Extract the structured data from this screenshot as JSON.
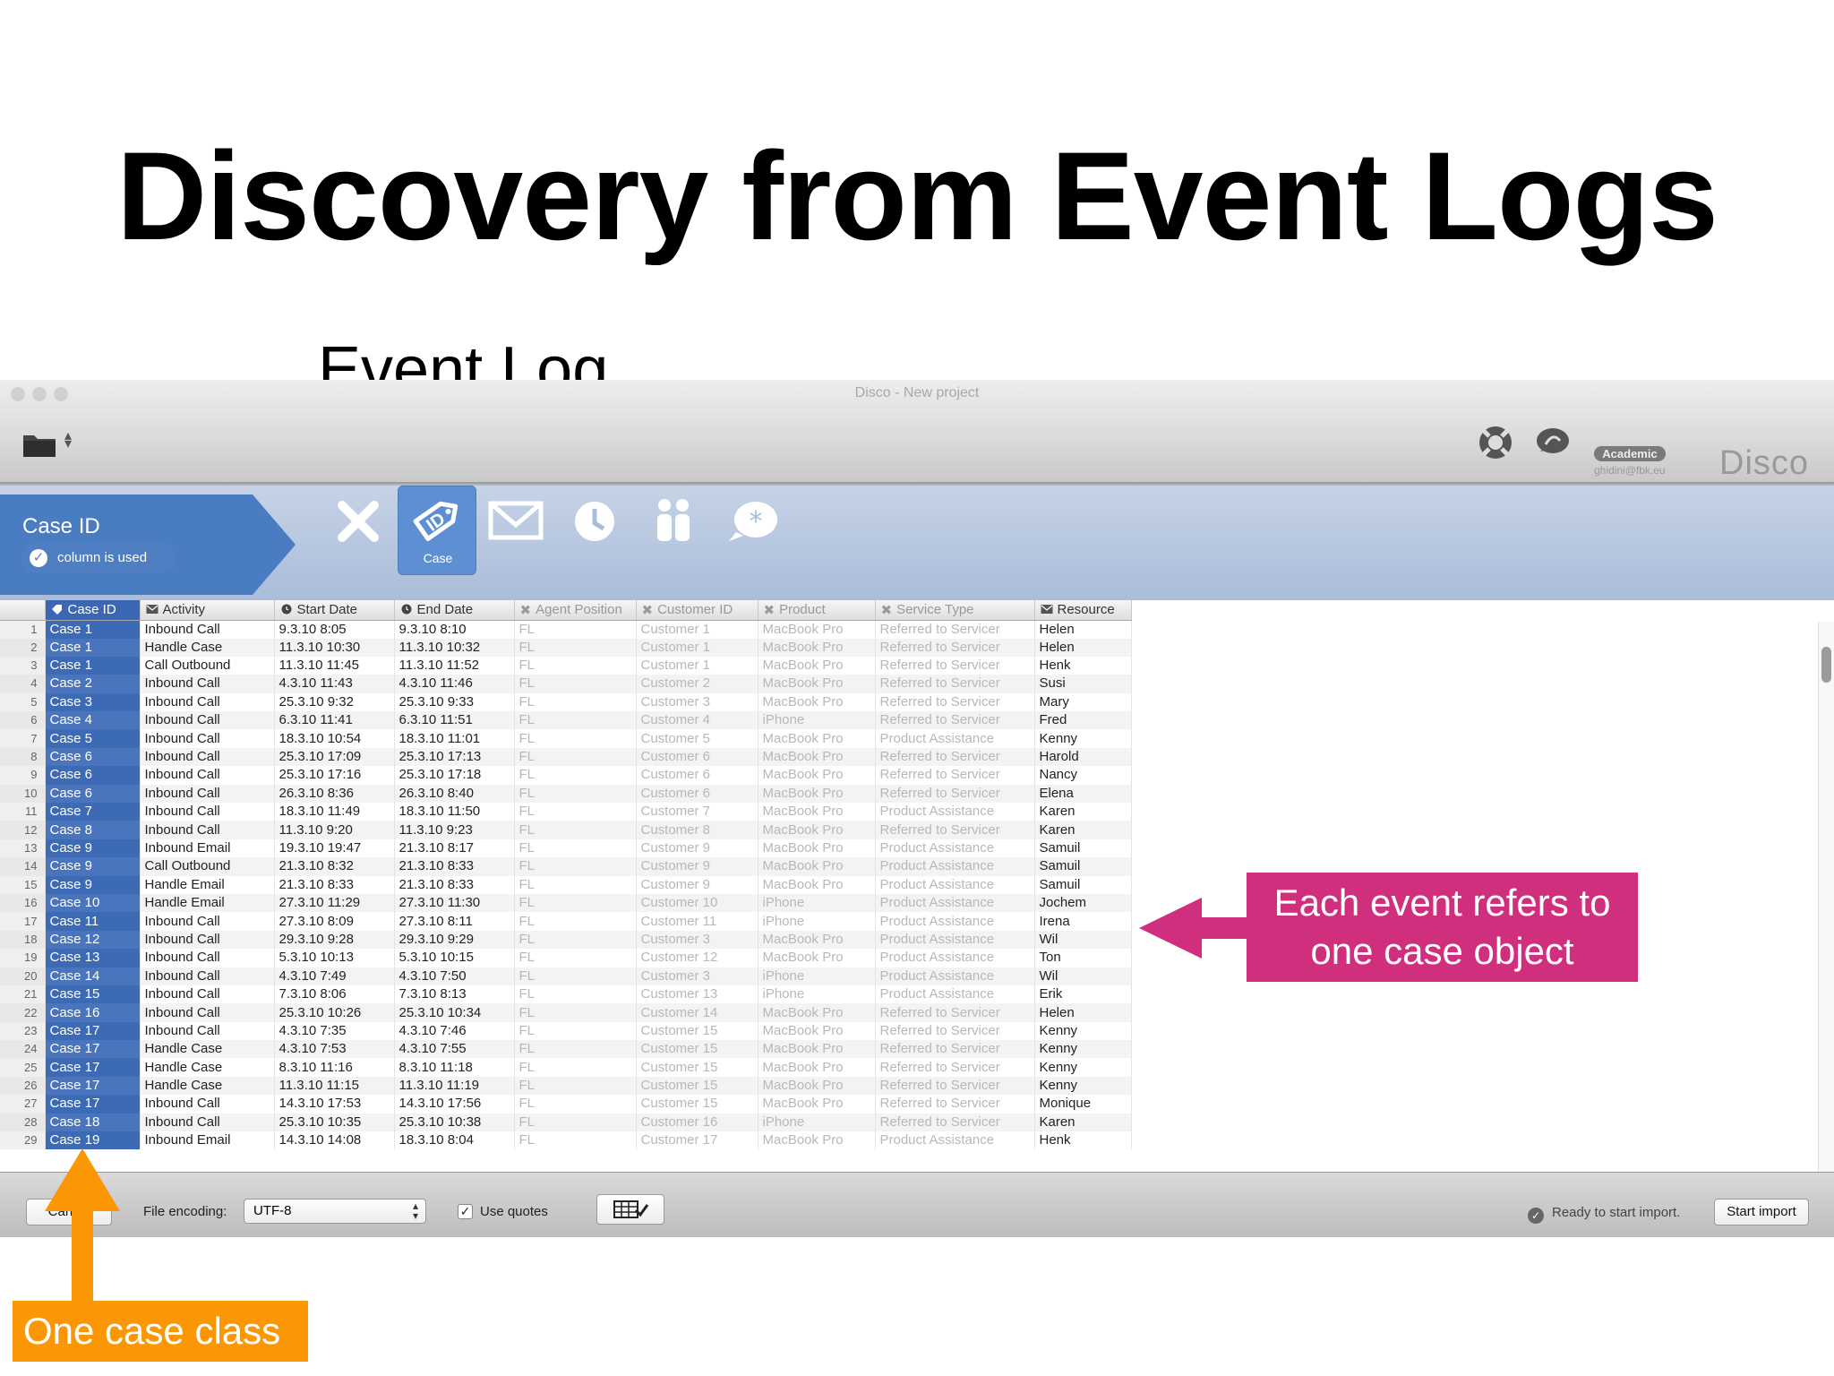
{
  "slide": {
    "title": "Discovery from Event Logs",
    "subtitle": "Event Log"
  },
  "window": {
    "title": "Disco - New project",
    "account_badge": "Academic",
    "account_email": "ghidini@fbk.eu",
    "logo": "Disco",
    "toolbar_icons": [
      "folder-icon",
      "help-lifebuoy-icon",
      "chat-icon"
    ]
  },
  "column_config": {
    "column_name": "Case ID",
    "status": "column is used",
    "selected_type_label": "Case",
    "type_options": [
      "ignore",
      "case",
      "activity",
      "timestamp",
      "resource",
      "other"
    ]
  },
  "table": {
    "headers": [
      "Case ID",
      "Activity",
      "Start Date",
      "End Date",
      "Agent Position",
      "Customer ID",
      "Product",
      "Service Type",
      "Resource"
    ],
    "rows": [
      [
        "Case 1",
        "Inbound Call",
        "9.3.10 8:05",
        "9.3.10 8:10",
        "FL",
        "Customer 1",
        "MacBook Pro",
        "Referred to Servicer",
        "Helen"
      ],
      [
        "Case 1",
        "Handle Case",
        "11.3.10 10:30",
        "11.3.10 10:32",
        "FL",
        "Customer 1",
        "MacBook Pro",
        "Referred to Servicer",
        "Helen"
      ],
      [
        "Case 1",
        "Call Outbound",
        "11.3.10 11:45",
        "11.3.10 11:52",
        "FL",
        "Customer 1",
        "MacBook Pro",
        "Referred to Servicer",
        "Henk"
      ],
      [
        "Case 2",
        "Inbound Call",
        "4.3.10 11:43",
        "4.3.10 11:46",
        "FL",
        "Customer 2",
        "MacBook Pro",
        "Referred to Servicer",
        "Susi"
      ],
      [
        "Case 3",
        "Inbound Call",
        "25.3.10 9:32",
        "25.3.10 9:33",
        "FL",
        "Customer 3",
        "MacBook Pro",
        "Referred to Servicer",
        "Mary"
      ],
      [
        "Case 4",
        "Inbound Call",
        "6.3.10 11:41",
        "6.3.10 11:51",
        "FL",
        "Customer 4",
        "iPhone",
        "Referred to Servicer",
        "Fred"
      ],
      [
        "Case 5",
        "Inbound Call",
        "18.3.10 10:54",
        "18.3.10 11:01",
        "FL",
        "Customer 5",
        "MacBook Pro",
        "Product Assistance",
        "Kenny"
      ],
      [
        "Case 6",
        "Inbound Call",
        "25.3.10 17:09",
        "25.3.10 17:13",
        "FL",
        "Customer 6",
        "MacBook Pro",
        "Referred to Servicer",
        "Harold"
      ],
      [
        "Case 6",
        "Inbound Call",
        "25.3.10 17:16",
        "25.3.10 17:18",
        "FL",
        "Customer 6",
        "MacBook Pro",
        "Referred to Servicer",
        "Nancy"
      ],
      [
        "Case 6",
        "Inbound Call",
        "26.3.10 8:36",
        "26.3.10 8:40",
        "FL",
        "Customer 6",
        "MacBook Pro",
        "Referred to Servicer",
        "Elena"
      ],
      [
        "Case 7",
        "Inbound Call",
        "18.3.10 11:49",
        "18.3.10 11:50",
        "FL",
        "Customer 7",
        "MacBook Pro",
        "Product Assistance",
        "Karen"
      ],
      [
        "Case 8",
        "Inbound Call",
        "11.3.10 9:20",
        "11.3.10 9:23",
        "FL",
        "Customer 8",
        "MacBook Pro",
        "Referred to Servicer",
        "Karen"
      ],
      [
        "Case 9",
        "Inbound Email",
        "19.3.10 19:47",
        "21.3.10 8:17",
        "FL",
        "Customer 9",
        "MacBook Pro",
        "Product Assistance",
        "Samuil"
      ],
      [
        "Case 9",
        "Call Outbound",
        "21.3.10 8:32",
        "21.3.10 8:33",
        "FL",
        "Customer 9",
        "MacBook Pro",
        "Product Assistance",
        "Samuil"
      ],
      [
        "Case 9",
        "Handle Email",
        "21.3.10 8:33",
        "21.3.10 8:33",
        "FL",
        "Customer 9",
        "MacBook Pro",
        "Product Assistance",
        "Samuil"
      ],
      [
        "Case 10",
        "Handle Email",
        "27.3.10 11:29",
        "27.3.10 11:30",
        "FL",
        "Customer 10",
        "iPhone",
        "Product Assistance",
        "Jochem"
      ],
      [
        "Case 11",
        "Inbound Call",
        "27.3.10 8:09",
        "27.3.10 8:11",
        "FL",
        "Customer 11",
        "iPhone",
        "Product Assistance",
        "Irena"
      ],
      [
        "Case 12",
        "Inbound Call",
        "29.3.10 9:28",
        "29.3.10 9:29",
        "FL",
        "Customer 3",
        "MacBook Pro",
        "Product Assistance",
        "Wil"
      ],
      [
        "Case 13",
        "Inbound Call",
        "5.3.10 10:13",
        "5.3.10 10:15",
        "FL",
        "Customer 12",
        "MacBook Pro",
        "Product Assistance",
        "Ton"
      ],
      [
        "Case 14",
        "Inbound Call",
        "4.3.10 7:49",
        "4.3.10 7:50",
        "FL",
        "Customer 3",
        "iPhone",
        "Product Assistance",
        "Wil"
      ],
      [
        "Case 15",
        "Inbound Call",
        "7.3.10 8:06",
        "7.3.10 8:13",
        "FL",
        "Customer 13",
        "iPhone",
        "Product Assistance",
        "Erik"
      ],
      [
        "Case 16",
        "Inbound Call",
        "25.3.10 10:26",
        "25.3.10 10:34",
        "FL",
        "Customer 14",
        "MacBook Pro",
        "Referred to Servicer",
        "Helen"
      ],
      [
        "Case 17",
        "Inbound Call",
        "4.3.10 7:35",
        "4.3.10 7:46",
        "FL",
        "Customer 15",
        "MacBook Pro",
        "Referred to Servicer",
        "Kenny"
      ],
      [
        "Case 17",
        "Handle Case",
        "4.3.10 7:53",
        "4.3.10 7:55",
        "FL",
        "Customer 15",
        "MacBook Pro",
        "Referred to Servicer",
        "Kenny"
      ],
      [
        "Case 17",
        "Handle Case",
        "8.3.10 11:16",
        "8.3.10 11:18",
        "FL",
        "Customer 15",
        "MacBook Pro",
        "Referred to Servicer",
        "Kenny"
      ],
      [
        "Case 17",
        "Handle Case",
        "11.3.10 11:15",
        "11.3.10 11:19",
        "FL",
        "Customer 15",
        "MacBook Pro",
        "Referred to Servicer",
        "Kenny"
      ],
      [
        "Case 17",
        "Inbound Call",
        "14.3.10 17:53",
        "14.3.10 17:56",
        "FL",
        "Customer 15",
        "MacBook Pro",
        "Referred to Servicer",
        "Monique"
      ],
      [
        "Case 18",
        "Inbound Call",
        "25.3.10 10:35",
        "25.3.10 10:38",
        "FL",
        "Customer 16",
        "iPhone",
        "Referred to Servicer",
        "Karen"
      ],
      [
        "Case 19",
        "Inbound Email",
        "14.3.10 14:08",
        "18.3.10 8:04",
        "FL",
        "Customer 17",
        "MacBook Pro",
        "Product Assistance",
        "Henk"
      ]
    ]
  },
  "footer": {
    "cancel_label": "Cancel",
    "encoding_label": "File encoding:",
    "encoding_value": "UTF-8",
    "use_quotes_label": "Use quotes",
    "use_quotes_checked": true,
    "status_text": "Ready to start import.",
    "start_label": "Start import"
  },
  "annotations": {
    "event_note_line1": "Each event refers to",
    "event_note_line2": "one case object",
    "case_class_note": "One case class",
    "pink_color": "#d02f7d",
    "orange_color": "#fb9604"
  }
}
